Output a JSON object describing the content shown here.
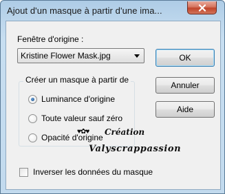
{
  "window": {
    "title": "Ajout d'un masque à partir d'une ima..."
  },
  "source": {
    "label": "Fenêtre d'origine :",
    "selected": "Kristine Flower Mask.jpg"
  },
  "group": {
    "legend": "Créer un masque à partir de",
    "options": [
      {
        "label": "Luminance d'origine",
        "checked": true
      },
      {
        "label": "Toute valeur sauf zéro",
        "checked": false
      },
      {
        "label": "Opacité d'origine",
        "checked": false
      }
    ]
  },
  "invert": {
    "label": "Inverser les données du masque",
    "checked": false
  },
  "buttons": {
    "ok": "OK",
    "cancel": "Annuler",
    "help": "Aide"
  },
  "watermark": {
    "line1": "Création",
    "line2": "Valyscrappassion"
  },
  "colors": {
    "title_bar": "#bcd6ec",
    "close": "#c7462c",
    "dialog_bg": "#f0f0f0",
    "default_button_border": "#3c7fb1"
  }
}
